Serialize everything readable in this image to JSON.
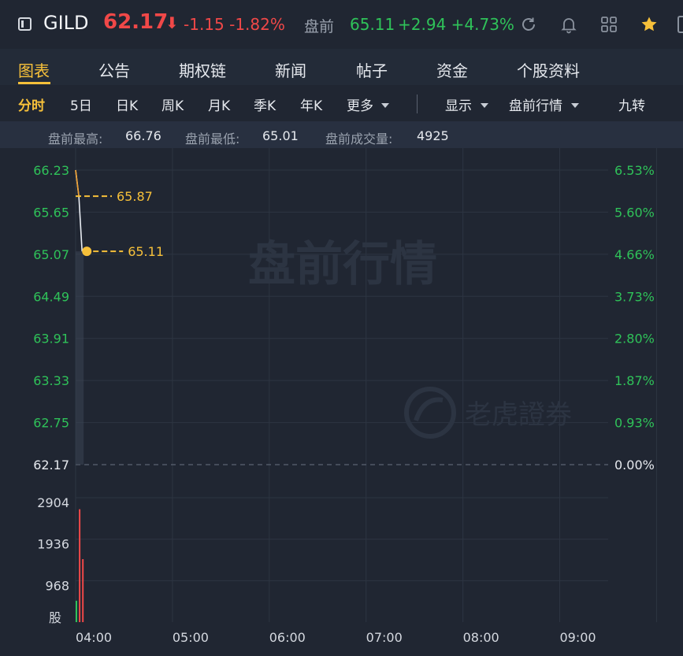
{
  "header": {
    "symbol": "GILD",
    "price": "62.17",
    "price_arrow": "⬇",
    "change": "-1.15 -1.82%",
    "premarket_label": "盘前",
    "premarket_price": "65.11",
    "premarket_change": "+2.94 +4.73%"
  },
  "tabs": [
    {
      "label": "图表"
    },
    {
      "label": "公告"
    },
    {
      "label": "期权链"
    },
    {
      "label": "新闻"
    },
    {
      "label": "帖子"
    },
    {
      "label": "资金"
    },
    {
      "label": "个股资料"
    }
  ],
  "periods": {
    "fenshi": "分时",
    "d5": "5日",
    "dayk": "日K",
    "weekk": "周K",
    "monthk": "月K",
    "quarterk": "季K",
    "yeark": "年K",
    "more": "更多",
    "display": "显示",
    "premarket_quote": "盘前行情",
    "jiuzhuan": "九转"
  },
  "stats": {
    "high_label": "盘前最高:",
    "high_value": "66.76",
    "low_label": "盘前最低:",
    "low_value": "65.01",
    "volume_label": "盘前成交量:",
    "volume_value": "4925"
  },
  "colors": {
    "up": "#2fc259",
    "down": "#f04848",
    "accent": "#f6c03a",
    "background": "#202632"
  },
  "chart_data": {
    "type": "line",
    "watermark": "盘前行情",
    "brand_watermark": "老虎證券",
    "base_price": 62.17,
    "ylim": [
      62.17,
      66.23
    ],
    "price_ticks": [
      "66.23",
      "65.65",
      "65.07",
      "64.49",
      "63.91",
      "63.33",
      "62.75",
      "62.17"
    ],
    "pct_ticks": [
      "6.53%",
      "5.60%",
      "4.66%",
      "3.73%",
      "2.80%",
      "1.87%",
      "0.93%",
      "0.00%"
    ],
    "x_ticks": [
      "04:00",
      "05:00",
      "06:00",
      "07:00",
      "08:00",
      "09:00"
    ],
    "xlim_minutes": [
      0,
      330
    ],
    "price_series": [
      {
        "t": 0,
        "v": 66.23
      },
      {
        "t": 2,
        "v": 65.87
      },
      {
        "t": 4,
        "v": 65.11
      }
    ],
    "avg_series": [
      {
        "t": 0,
        "v": 66.23
      },
      {
        "t": 2,
        "v": 65.87
      }
    ],
    "annotations": [
      {
        "label": "65.87",
        "t": 0,
        "v": 65.87
      },
      {
        "label": "65.11",
        "t": 4,
        "v": 65.11
      }
    ],
    "volume_ticks": [
      "2904",
      "1936",
      "968"
    ],
    "volume_unit": "股",
    "volume_max": 3200,
    "volume_bars": [
      {
        "t": 0,
        "v": 550,
        "dir": "up"
      },
      {
        "t": 2,
        "v": 2904,
        "dir": "down"
      },
      {
        "t": 4,
        "v": 1620,
        "dir": "down"
      }
    ]
  }
}
